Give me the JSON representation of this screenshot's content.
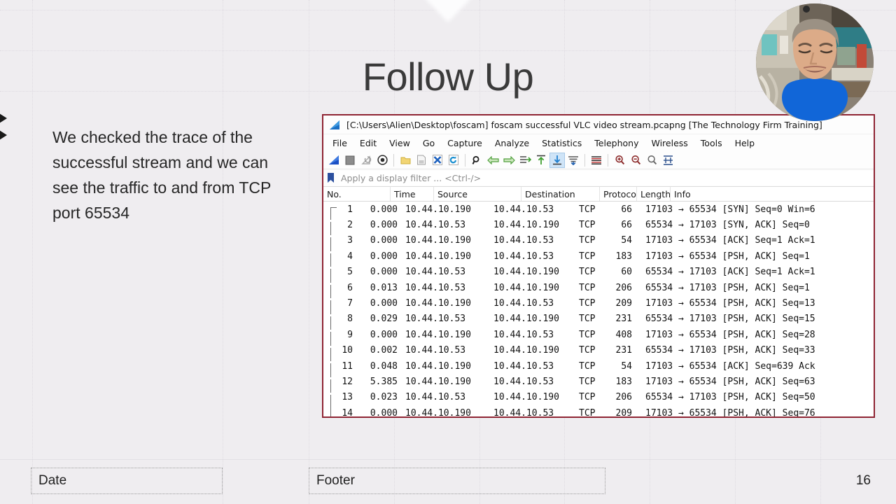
{
  "slide": {
    "title": "Follow Up",
    "body_text": "We checked the trace of the successful stream and we can see the traffic to and from TCP port 65534",
    "footer": {
      "date_placeholder": "Date",
      "footer_placeholder": "Footer",
      "page_number": "16"
    },
    "background_color": "#efedf0"
  },
  "wireshark": {
    "border_color": "#8f2433",
    "title": "[C:\\Users\\Alien\\Desktop\\foscam] foscam successful VLC video stream.pcapng [The Technology Firm Training]",
    "menu": [
      "File",
      "Edit",
      "View",
      "Go",
      "Capture",
      "Analyze",
      "Statistics",
      "Telephony",
      "Wireless",
      "Tools",
      "Help"
    ],
    "toolbar_icons": [
      "start-capture-icon",
      "stop-capture-icon",
      "restart-capture-icon",
      "capture-options-icon",
      "open-file-icon",
      "save-file-icon",
      "close-file-icon",
      "reload-file-icon",
      "find-packet-icon",
      "go-back-icon",
      "go-forward-icon",
      "go-to-packet-icon",
      "go-to-first-packet-icon",
      "go-to-last-packet-icon",
      "auto-scroll-icon",
      "colorize-packets-icon",
      "zoom-in-icon",
      "zoom-out-icon",
      "zoom-reset-icon",
      "resize-columns-icon"
    ],
    "filter": {
      "icon": "bookmark-icon",
      "placeholder": "Apply a display filter ... <Ctrl-/>",
      "value": ""
    },
    "columns": [
      "No.",
      "Time",
      "Source",
      "Destination",
      "Protocol",
      "Length",
      "Info"
    ],
    "packets": [
      {
        "no": "1",
        "time": "0.000",
        "src": "10.44.10.190",
        "dst": "10.44.10.53",
        "proto": "TCP",
        "len": "66",
        "info": "17103 → 65534 [SYN] Seq=0 Win=6"
      },
      {
        "no": "2",
        "time": "0.000",
        "src": "10.44.10.53",
        "dst": "10.44.10.190",
        "proto": "TCP",
        "len": "66",
        "info": "65534 → 17103 [SYN, ACK] Seq=0"
      },
      {
        "no": "3",
        "time": "0.000",
        "src": "10.44.10.190",
        "dst": "10.44.10.53",
        "proto": "TCP",
        "len": "54",
        "info": "17103 → 65534 [ACK] Seq=1 Ack=1"
      },
      {
        "no": "4",
        "time": "0.000",
        "src": "10.44.10.190",
        "dst": "10.44.10.53",
        "proto": "TCP",
        "len": "183",
        "info": "17103 → 65534 [PSH, ACK] Seq=1"
      },
      {
        "no": "5",
        "time": "0.000",
        "src": "10.44.10.53",
        "dst": "10.44.10.190",
        "proto": "TCP",
        "len": "60",
        "info": "65534 → 17103 [ACK] Seq=1 Ack=1"
      },
      {
        "no": "6",
        "time": "0.013",
        "src": "10.44.10.53",
        "dst": "10.44.10.190",
        "proto": "TCP",
        "len": "206",
        "info": "65534 → 17103 [PSH, ACK] Seq=1"
      },
      {
        "no": "7",
        "time": "0.000",
        "src": "10.44.10.190",
        "dst": "10.44.10.53",
        "proto": "TCP",
        "len": "209",
        "info": "17103 → 65534 [PSH, ACK] Seq=13"
      },
      {
        "no": "8",
        "time": "0.029",
        "src": "10.44.10.53",
        "dst": "10.44.10.190",
        "proto": "TCP",
        "len": "231",
        "info": "65534 → 17103 [PSH, ACK] Seq=15"
      },
      {
        "no": "9",
        "time": "0.000",
        "src": "10.44.10.190",
        "dst": "10.44.10.53",
        "proto": "TCP",
        "len": "408",
        "info": "17103 → 65534 [PSH, ACK] Seq=28"
      },
      {
        "no": "10",
        "time": "0.002",
        "src": "10.44.10.53",
        "dst": "10.44.10.190",
        "proto": "TCP",
        "len": "231",
        "info": "65534 → 17103 [PSH, ACK] Seq=33"
      },
      {
        "no": "11",
        "time": "0.048",
        "src": "10.44.10.190",
        "dst": "10.44.10.53",
        "proto": "TCP",
        "len": "54",
        "info": "17103 → 65534 [ACK] Seq=639 Ack"
      },
      {
        "no": "12",
        "time": "5.385",
        "src": "10.44.10.190",
        "dst": "10.44.10.53",
        "proto": "TCP",
        "len": "183",
        "info": "17103 → 65534 [PSH, ACK] Seq=63"
      },
      {
        "no": "13",
        "time": "0.023",
        "src": "10.44.10.53",
        "dst": "10.44.10.190",
        "proto": "TCP",
        "len": "206",
        "info": "65534 → 17103 [PSH, ACK] Seq=50"
      },
      {
        "no": "14",
        "time": "0.000",
        "src": "10.44.10.190",
        "dst": "10.44.10.53",
        "proto": "TCP",
        "len": "209",
        "info": "17103 → 65534 [PSH, ACK] Seq=76"
      }
    ]
  },
  "webcam": {
    "label": "presenter-webcam",
    "shirt_color": "#1166d8",
    "skin_color": "#d9a583",
    "background_color": "#7d766a"
  }
}
